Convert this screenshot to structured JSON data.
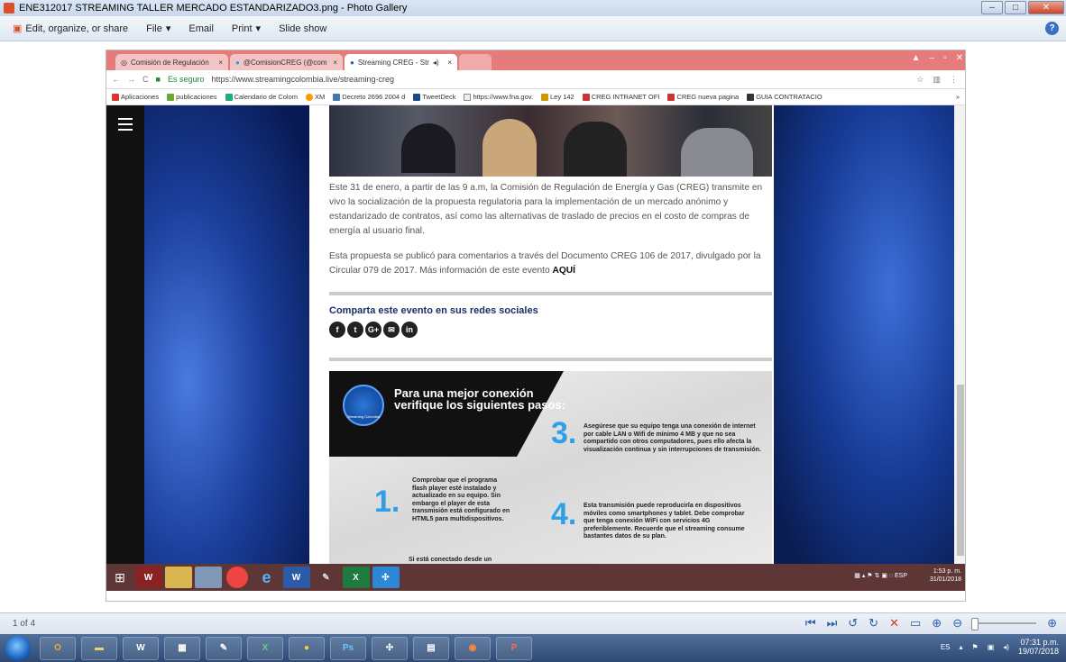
{
  "window": {
    "title": "ENE312017 STREAMING TALLER MERCADO ESTANDARIZADO3.png - Photo Gallery"
  },
  "menu": {
    "items": [
      "Edit, organize, or share",
      "File",
      "Email",
      "Print",
      "Slide show"
    ]
  },
  "browser": {
    "tabs": [
      {
        "label": "Comisión de Regulación"
      },
      {
        "label": "@ComisionCREG (@com"
      },
      {
        "label": "Streaming CREG - Str"
      }
    ],
    "secure_label": "Es seguro",
    "url": "https://www.streamingcolombia.live/streaming-creg",
    "bookmarks": [
      "Aplicaciones",
      "publicaciones",
      "Calendario de Colom",
      "XM",
      "Decreto 2696 2004 d",
      "TweetDeck",
      "https://www.fna.gov.",
      "Ley 142",
      "CREG INTRANET OFI",
      "CREG nueva pagina",
      "GUIA CONTRATACIO"
    ]
  },
  "article": {
    "para1": "Este 31 de enero, a partir de las 9 a.m, la Comisión de Regulación de Energía y Gas (CREG) transmite en vivo la socialización de la propuesta regulatoria para la implementación de un mercado anónimo y estandarizado de contratos, así como las alternativas de traslado de precios en el costo de compras de energía al usuario final.",
    "para2": "Esta propuesta se publicó para comentarios a través del Documento CREG 106 de 2017, divulgado por la Circular 079 de 2017. Más información de este evento",
    "para2_link": "AQUÍ",
    "share_title": "Comparta este evento en sus redes sociales"
  },
  "infographic": {
    "logo_label": "Streaming Colombia",
    "title": "Para una mejor conexión verifique los siguientes pasos:",
    "steps": [
      {
        "num": "1.",
        "text": "Comprobar que el programa flash player esté instalado y actualizado en su equipo. Sin embargo el player de esta transmisión está configurado en HTML5 para multidispositivos."
      },
      {
        "num": "3.",
        "text": "Asegúrese que su equipo tenga una conexión de internet por cable LAN o Wifi de mínimo 4 MB y que no sea compartido con otros computadores, pues ello afecta la visualización continua y sin interrupciones de transmisión."
      },
      {
        "num": "4.",
        "text": "Esta transmisión puede reproducirla en dispositivos móviles como smartphones y tablet. Debe comprobar que tenga conexión WiFi con servicios 4G preferiblemente. Recuerde que el streaming consume bastantes datos de su plan."
      }
    ],
    "cutoff_text": "Si está conectado desde un"
  },
  "inner_taskbar": {
    "lang": "ESP",
    "time": "1:53 p. m.",
    "date": "31/01/2018"
  },
  "status": {
    "page": "1 of 4"
  },
  "taskbar": {
    "lang": "ES",
    "time": "07:31 p.m.",
    "date": "19/07/2018"
  }
}
